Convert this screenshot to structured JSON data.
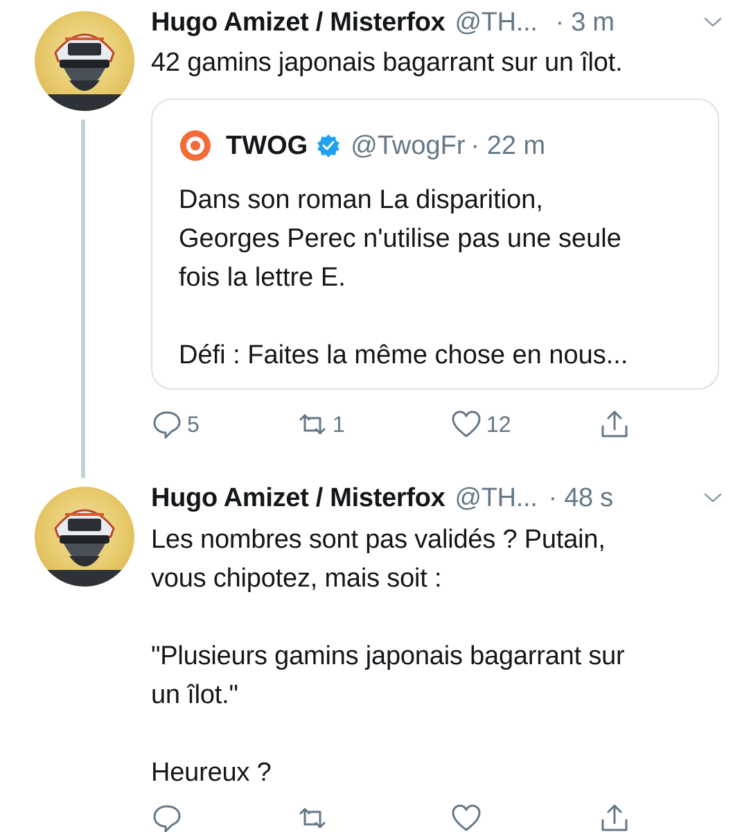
{
  "tweets": [
    {
      "author_name": "Hugo Amizet / Misterfox",
      "author_handle": "@TH...",
      "time": "· 3 m",
      "text": "42 gamins japonais bagarrant sur un îlot.",
      "quoted": {
        "name": "TWOG",
        "handle": "@TwogFr",
        "time": "· 22 m",
        "text": "Dans son roman La disparition,\nGeorges Perec n'utilise pas une seule\nfois la lettre E.\n\nDéfi : Faites la même chose en nous..."
      },
      "actions": {
        "reply": "5",
        "retweet": "1",
        "like": "12"
      }
    },
    {
      "author_name": "Hugo Amizet / Misterfox",
      "author_handle": "@TH...",
      "time": "· 48 s",
      "text": "Les nombres sont pas validés ? Putain,\nvous chipotez, mais soit :\n\n\"Plusieurs gamins japonais bagarrant sur\nun îlot.\"\n\nHeureux ?",
      "actions": {
        "reply": "",
        "retweet": "",
        "like": ""
      }
    }
  ],
  "icons": {
    "reply": "reply-icon",
    "retweet": "retweet-icon",
    "like": "heart-icon",
    "share": "share-icon",
    "more": "chevron-down-icon",
    "verified": "verified-badge-icon",
    "quote_logo": "twog-logo-icon"
  },
  "colors": {
    "text": "#14171a",
    "muted": "#657786",
    "border": "#d9e1e8",
    "thread_line": "#c4cfd6",
    "verified": "#1da1f2",
    "twog_orange": "#f26b38"
  }
}
